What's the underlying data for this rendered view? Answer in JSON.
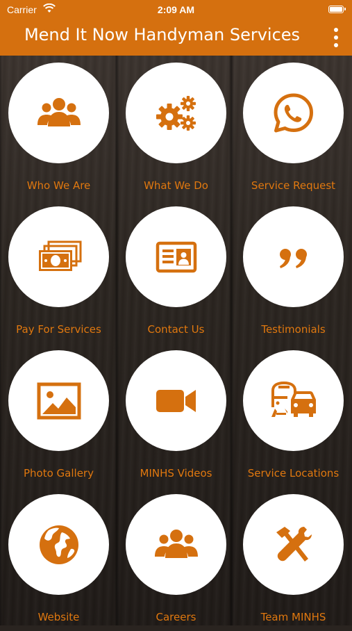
{
  "status_bar": {
    "carrier": "Carrier",
    "time": "2:09 AM"
  },
  "header": {
    "title": "Mend It Now Handyman Services",
    "menu_icon": "more-vertical-icon"
  },
  "theme": {
    "accent": "#d5700f",
    "label_color": "#e0780f",
    "circle_bg": "#ffffff"
  },
  "menu": [
    {
      "label": "Who We Are",
      "icon": "people-group-icon"
    },
    {
      "label": "What We Do",
      "icon": "gears-icon"
    },
    {
      "label": "Service Request",
      "icon": "whatsapp-icon"
    },
    {
      "label": "Pay For Services",
      "icon": "money-icon"
    },
    {
      "label": "Contact Us",
      "icon": "contact-card-icon"
    },
    {
      "label": "Testimonials",
      "icon": "quote-icon"
    },
    {
      "label": "Photo Gallery",
      "icon": "image-icon"
    },
    {
      "label": "MINHS Videos",
      "icon": "video-camera-icon"
    },
    {
      "label": "Service Locations",
      "icon": "vehicles-icon"
    },
    {
      "label": "Website",
      "icon": "globe-icon"
    },
    {
      "label": "Careers",
      "icon": "people-group-icon"
    },
    {
      "label": "Team MINHS",
      "icon": "tools-icon"
    }
  ]
}
